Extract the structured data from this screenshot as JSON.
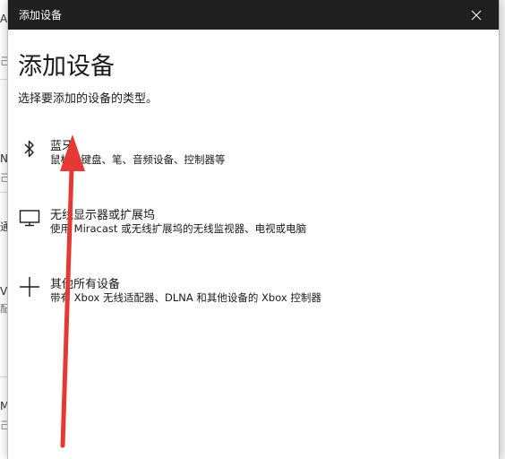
{
  "dialog": {
    "window_title": "添加设备",
    "heading": "添加设备",
    "subheading": "选择要添加的设备的类型。",
    "close_icon": "close-icon"
  },
  "options": [
    {
      "icon": "bluetooth-icon",
      "label": "蓝牙",
      "description": "鼠标、键盘、笔、音频设备、控制器等"
    },
    {
      "icon": "monitor-icon",
      "label": "无线显示器或扩展坞",
      "description": "使用 Miracast 或无线扩展坞的无线监视器、电视或电脑"
    },
    {
      "icon": "plus-icon",
      "label": "其他所有设备",
      "description": "带有 Xbox 无线适配器、DLNA 和其他设备的 Xbox 控制器"
    }
  ],
  "background_fragments": [
    "A",
    "己",
    "N",
    "己",
    "通",
    "V",
    "配",
    "Mi",
    "己"
  ],
  "annotation": {
    "arrow_color": "#e53935"
  }
}
